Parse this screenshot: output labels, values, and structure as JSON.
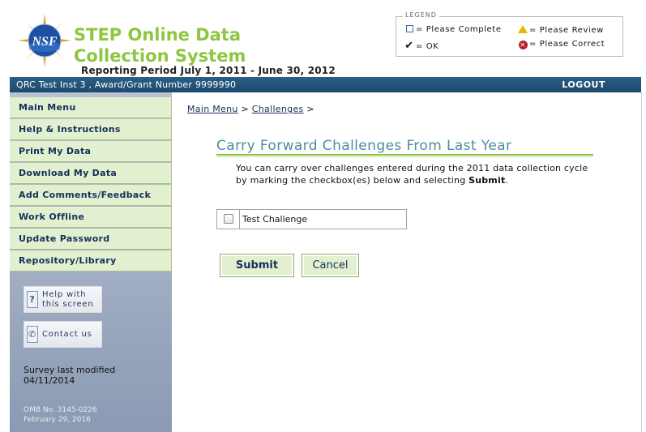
{
  "header": {
    "title": "STEP Online Data Collection System",
    "reporting_period": "Reporting Period July 1, 2011 - June 30, 2012",
    "legend": {
      "title": "LEGEND",
      "please_complete": "= Please Complete",
      "ok": "= OK",
      "please_review": "= Please Review",
      "please_correct": "= Please Correct"
    }
  },
  "bar": {
    "institution": "QRC Test Inst 3 , Award/Grant Number 9999990",
    "logout": "LOGOUT"
  },
  "sidebar": {
    "items": [
      {
        "label": "Main Menu"
      },
      {
        "label": "Help & Instructions"
      },
      {
        "label": "Print My Data"
      },
      {
        "label": "Download My Data"
      },
      {
        "label": "Add Comments/Feedback"
      },
      {
        "label": "Work Offline"
      },
      {
        "label": "Update Password"
      },
      {
        "label": "Repository/Library"
      }
    ],
    "help_line1": "Help with",
    "help_line2": "this screen",
    "contact": "Contact us",
    "survey_line1": "Survey last modified",
    "survey_line2": "04/11/2014",
    "omb_line1": "OMB No. 3145-0226",
    "omb_line2": "February 29, 2016"
  },
  "main": {
    "breadcrumb": {
      "main_menu": "Main Menu",
      "sep1": " > ",
      "challenges": "Challenges",
      "sep2": " >"
    },
    "title": "Carry Forward Challenges From Last Year",
    "desc_text": "You can carry over challenges entered during the 2011 data collection cycle by marking the checkbox(es) below and selecting ",
    "desc_bold": "Submit",
    "desc_end": ".",
    "challenge_label": "Test Challenge",
    "submit": "Submit",
    "cancel": "Cancel"
  },
  "colors": {
    "accent_green": "#8dc63f",
    "bar_blue": "#1d4a6c",
    "nav_green": "#e3f0cf",
    "title_teal": "#4f8ba0"
  }
}
